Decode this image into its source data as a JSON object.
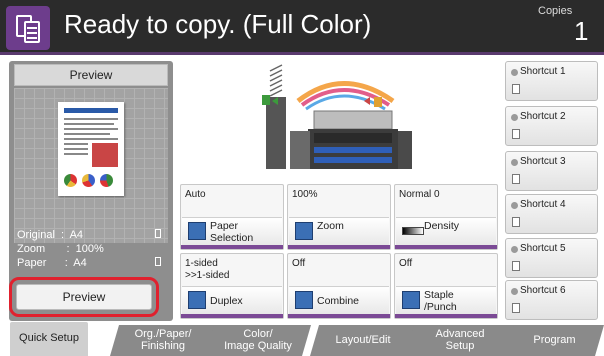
{
  "header": {
    "title": "Ready to copy. (Full Color)",
    "copies_label": "Copies",
    "copies_value": "1"
  },
  "preview_panel": {
    "heading": "Preview",
    "original": "Original  :  A4",
    "zoom": "Zoom       :  100%",
    "paper": "Paper      :  A4",
    "preview_button": "Preview"
  },
  "functions": [
    {
      "value": "Auto",
      "name": "Paper\nSelection",
      "icon": "paper-selection-icon"
    },
    {
      "value": "100%",
      "name": "Zoom",
      "icon": "zoom-icon"
    },
    {
      "value": "Normal 0",
      "name": "Density",
      "icon": "density-icon"
    },
    {
      "value": "1-sided\n>>1-sided",
      "name": "Duplex",
      "icon": "duplex-icon"
    },
    {
      "value": "Off",
      "name": "Combine",
      "icon": "combine-icon"
    },
    {
      "value": "Off",
      "name": "Staple\n/Punch",
      "icon": "staple-punch-icon"
    }
  ],
  "shortcuts": [
    "Shortcut 1",
    "Shortcut 2",
    "Shortcut 3",
    "Shortcut 4",
    "Shortcut 5",
    "Shortcut 6"
  ],
  "tabs": [
    {
      "label": "Quick Setup",
      "active": true
    },
    {
      "label": "Org./Paper/\nFinishing",
      "active": false
    },
    {
      "label": "Color/\nImage Quality",
      "active": false
    },
    {
      "label": "Layout/Edit",
      "active": false
    },
    {
      "label": "Advanced\nSetup",
      "active": false
    },
    {
      "label": "Program",
      "active": false
    }
  ],
  "colors": {
    "header_bg": "#2b2b2b",
    "accent_purple": "#7b4a95",
    "highlight_red": "#e0212e"
  }
}
